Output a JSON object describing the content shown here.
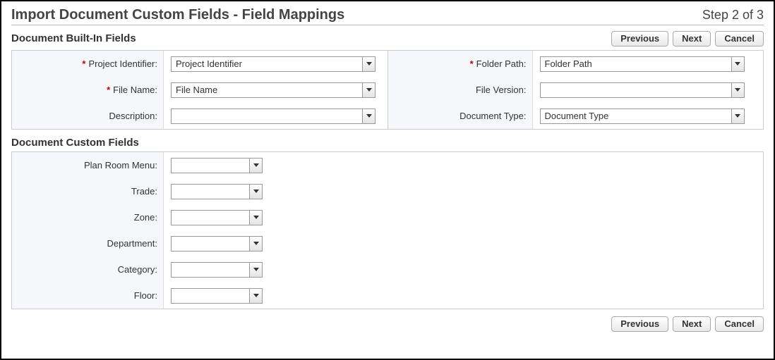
{
  "header": {
    "title": "Import Document Custom Fields - Field Mappings",
    "step": "Step 2 of 3"
  },
  "buttons": {
    "previous": "Previous",
    "next": "Next",
    "cancel": "Cancel"
  },
  "sections": {
    "builtin_title": "Document Built-In Fields",
    "custom_title": "Document Custom Fields"
  },
  "builtin": {
    "left": [
      {
        "label": "Project Identifier:",
        "required": true,
        "value": "Project Identifier"
      },
      {
        "label": "File Name:",
        "required": true,
        "value": "File Name"
      },
      {
        "label": "Description:",
        "required": false,
        "value": ""
      }
    ],
    "right": [
      {
        "label": "Folder Path:",
        "required": true,
        "value": "Folder Path"
      },
      {
        "label": "File Version:",
        "required": false,
        "value": ""
      },
      {
        "label": "Document Type:",
        "required": false,
        "value": "Document Type"
      }
    ]
  },
  "custom": [
    {
      "label": "Plan Room Menu:",
      "value": ""
    },
    {
      "label": "Trade:",
      "value": ""
    },
    {
      "label": "Zone:",
      "value": ""
    },
    {
      "label": "Department:",
      "value": ""
    },
    {
      "label": "Category:",
      "value": ""
    },
    {
      "label": "Floor:",
      "value": ""
    }
  ]
}
